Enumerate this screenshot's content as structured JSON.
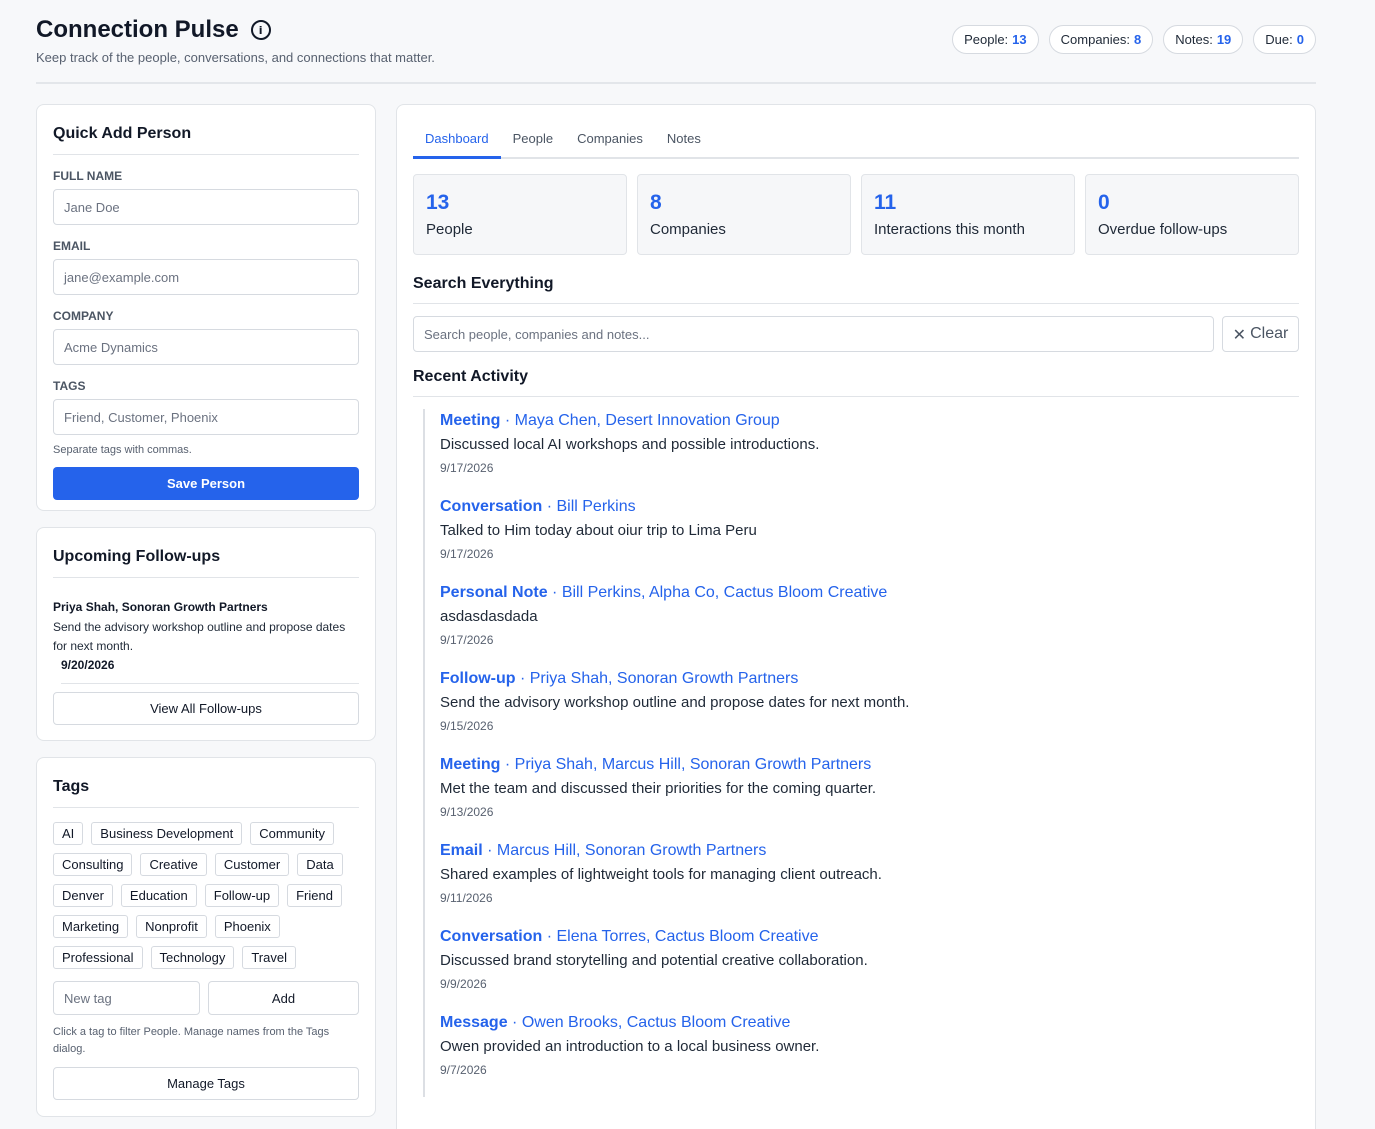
{
  "app": {
    "title": "Connection Pulse",
    "subtitle": "Keep track of the people, conversations, and connections that matter."
  },
  "header_stats": [
    {
      "label": "People:",
      "value": "13"
    },
    {
      "label": "Companies:",
      "value": "8"
    },
    {
      "label": "Notes:",
      "value": "19"
    },
    {
      "label": "Due:",
      "value": "0"
    }
  ],
  "quick_add": {
    "title": "Quick Add Person",
    "fields": [
      {
        "label": "Full Name",
        "placeholder": "Jane Doe"
      },
      {
        "label": "Email",
        "placeholder": "jane@example.com"
      },
      {
        "label": "Company",
        "placeholder": "Acme Dynamics"
      },
      {
        "label": "Tags",
        "placeholder": "Friend, Customer, Phoenix"
      }
    ],
    "hint": "Separate tags with commas.",
    "save_label": "Save Person"
  },
  "followups": {
    "title": "Upcoming Follow-ups",
    "item": {
      "name": "Priya Shah, Sonoran Growth Partners",
      "text": "Send the advisory workshop outline and propose dates for next month.",
      "date": "9/20/2026"
    },
    "view_all_label": "View All Follow-ups"
  },
  "tags": {
    "title": "Tags",
    "items": [
      "AI",
      "Business Development",
      "Community",
      "Consulting",
      "Creative",
      "Customer",
      "Data",
      "Denver",
      "Education",
      "Follow-up",
      "Friend",
      "Marketing",
      "Nonprofit",
      "Phoenix",
      "Professional",
      "Technology",
      "Travel"
    ],
    "new_tag_placeholder": "New tag",
    "add_label": "Add",
    "hint": "Click a tag to filter People. Manage names from the Tags dialog.",
    "manage_label": "Manage Tags"
  },
  "tabs": [
    {
      "label": "Dashboard",
      "active": true
    },
    {
      "label": "People",
      "active": false
    },
    {
      "label": "Companies",
      "active": false
    },
    {
      "label": "Notes",
      "active": false
    }
  ],
  "dashboard_stats": [
    {
      "value": "13",
      "label": "People"
    },
    {
      "value": "8",
      "label": "Companies"
    },
    {
      "value": "11",
      "label": "Interactions this month"
    },
    {
      "value": "0",
      "label": "Overdue follow-ups"
    }
  ],
  "search": {
    "title": "Search Everything",
    "placeholder": "Search people, companies and notes...",
    "clear_label": "Clear"
  },
  "recent": {
    "title": "Recent Activity",
    "items": [
      {
        "type": "Meeting",
        "who": " · Maya Chen, Desert Innovation Group",
        "text": "Discussed local AI workshops and possible introductions.",
        "date": "9/17/2026"
      },
      {
        "type": "Conversation",
        "who": " · Bill Perkins",
        "text": "Talked to Him today about oiur trip to Lima Peru",
        "date": "9/17/2026"
      },
      {
        "type": "Personal Note",
        "who": " · Bill Perkins, Alpha Co, Cactus Bloom Creative",
        "text": "asdasdasdada",
        "date": "9/17/2026"
      },
      {
        "type": "Follow-up",
        "who": " · Priya Shah, Sonoran Growth Partners",
        "text": "Send the advisory workshop outline and propose dates for next month.",
        "date": "9/15/2026"
      },
      {
        "type": "Meeting",
        "who": " · Priya Shah, Marcus Hill, Sonoran Growth Partners",
        "text": "Met the team and discussed their priorities for the coming quarter.",
        "date": "9/13/2026"
      },
      {
        "type": "Email",
        "who": " · Marcus Hill, Sonoran Growth Partners",
        "text": "Shared examples of lightweight tools for managing client outreach.",
        "date": "9/11/2026"
      },
      {
        "type": "Conversation",
        "who": " · Elena Torres, Cactus Bloom Creative",
        "text": "Discussed brand storytelling and potential creative collaboration.",
        "date": "9/9/2026"
      },
      {
        "type": "Message",
        "who": " · Owen Brooks, Cactus Bloom Creative",
        "text": "Owen provided an introduction to a local business owner.",
        "date": "9/7/2026"
      }
    ]
  }
}
